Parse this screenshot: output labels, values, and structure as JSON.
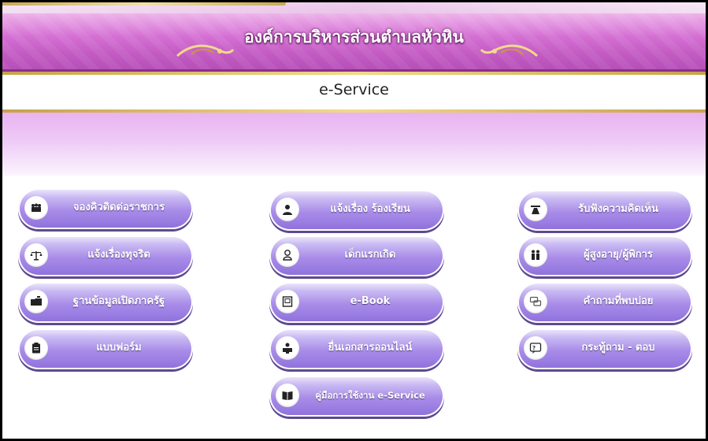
{
  "header": {
    "org_name": "องค์การบริหารส่วนตำบลหัวหิน",
    "section_title": "e-Service"
  },
  "colors": {
    "banner_purple": "#c45cc4",
    "button_purple": "#9a7de2",
    "gold": "#d9b86a"
  },
  "buttons": [
    {
      "id": "queue",
      "label": "จองคิวติดต่อราชการ",
      "icon": "people-icon"
    },
    {
      "id": "report",
      "label": "แจ้งเรื่อง ร้องเรียน",
      "icon": "person-icon"
    },
    {
      "id": "opinion",
      "label": "รับฟังความคิดเห็น",
      "icon": "road-icon"
    },
    {
      "id": "corruption",
      "label": "แจ้งเรื่องทุจริต",
      "icon": "scale-icon"
    },
    {
      "id": "newborn",
      "label": "เด็กแรกเกิด",
      "icon": "baby-icon"
    },
    {
      "id": "elderly",
      "label": "ผู้สูงอายุ/ผู้พิการ",
      "icon": "couple-icon"
    },
    {
      "id": "open_data",
      "label": "ฐานข้อมูลเปิดภาครัฐ",
      "icon": "folder-icon"
    },
    {
      "id": "ebook",
      "label": "e-Book",
      "icon": "book-icon"
    },
    {
      "id": "faq",
      "label": "คำถามที่พบบ่อย",
      "icon": "chat-icon"
    },
    {
      "id": "forms",
      "label": "แบบฟอร์ม",
      "icon": "clipboard-icon"
    },
    {
      "id": "online_docs",
      "label": "ยื่นเอกสารออนไลน์",
      "icon": "desk-icon"
    },
    {
      "id": "qa",
      "label": "กระทู้ถาม - ตอบ",
      "icon": "forum-icon"
    },
    {
      "id": "manual",
      "label": "คู่มือการใช้งาน e-Service",
      "icon": "manual-icon"
    }
  ]
}
